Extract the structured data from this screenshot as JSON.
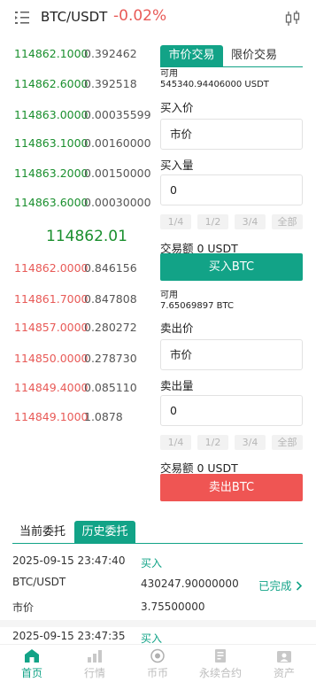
{
  "header": {
    "pair": "BTC/USDT",
    "change": "-0.02%"
  },
  "orderbook": {
    "buy": [
      {
        "price": "114862.1000",
        "qty": "0.392462"
      },
      {
        "price": "114862.6000",
        "qty": "0.392518"
      },
      {
        "price": "114863.0000",
        "qty": "0.00035599"
      },
      {
        "price": "114863.1000",
        "qty": "0.00160000"
      },
      {
        "price": "114863.2000",
        "qty": "0.00150000"
      },
      {
        "price": "114863.6000",
        "qty": "0.00030000"
      }
    ],
    "last_price": "114862.01",
    "sell": [
      {
        "price": "114862.0000",
        "qty": "0.846156"
      },
      {
        "price": "114861.7000",
        "qty": "0.847808"
      },
      {
        "price": "114857.0000",
        "qty": "0.280272"
      },
      {
        "price": "114850.0000",
        "qty": "0.278730"
      },
      {
        "price": "114849.4000",
        "qty": "0.085110"
      },
      {
        "price": "114849.1000",
        "qty": "1.0878"
      }
    ]
  },
  "trade": {
    "tabs": [
      "市价交易",
      "限价交易"
    ],
    "buy": {
      "available_label": "可用",
      "available_value": "545340.94406000 USDT",
      "price_label": "买入价",
      "price_value": "市价",
      "amount_label": "买入量",
      "amount_value": "0",
      "percents": [
        "1/4",
        "1/2",
        "3/4",
        "全部"
      ],
      "total": "交易额 0 USDT",
      "button": "买入BTC"
    },
    "sell": {
      "available_label": "可用",
      "available_value": "7.65069897 BTC",
      "price_label": "卖出价",
      "price_value": "市价",
      "amount_label": "卖出量",
      "amount_value": "0",
      "percents": [
        "1/4",
        "1/2",
        "3/4",
        "全部"
      ],
      "total": "交易额 0 USDT",
      "button": "卖出BTC"
    }
  },
  "orders": {
    "tabs": [
      "当前委托",
      "历史委托"
    ],
    "items": [
      {
        "time": "2025-09-15 23:47:40",
        "side": "买入",
        "pair": "BTC/USDT",
        "amount": "430247.90000000",
        "status": "已完成",
        "type": "市价",
        "price": "3.75500000"
      },
      {
        "time": "2025-09-15 23:47:35",
        "side": "买入"
      }
    ]
  },
  "nav": {
    "items": [
      {
        "label": "首页",
        "icon": "home-icon"
      },
      {
        "label": "行情",
        "icon": "market-icon"
      },
      {
        "label": "币币",
        "icon": "coin-icon"
      },
      {
        "label": "永续合约",
        "icon": "contract-icon"
      },
      {
        "label": "资产",
        "icon": "assets-icon"
      }
    ]
  },
  "colors": {
    "accent": "#12a387",
    "buy_price": "#1a8f2e",
    "sell_price": "#e85a57",
    "sell_button": "#ef5553"
  }
}
